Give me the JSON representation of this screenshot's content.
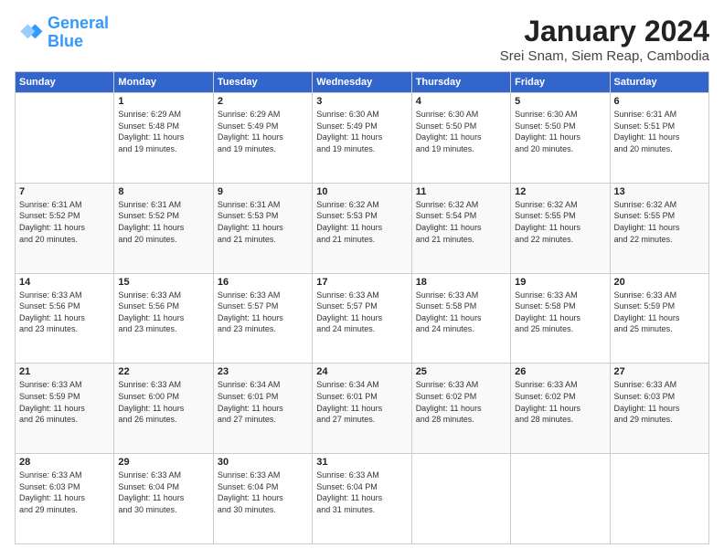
{
  "header": {
    "logo_line1": "General",
    "logo_line2": "Blue",
    "month_title": "January 2024",
    "subtitle": "Srei Snam, Siem Reap, Cambodia"
  },
  "weekdays": [
    "Sunday",
    "Monday",
    "Tuesday",
    "Wednesday",
    "Thursday",
    "Friday",
    "Saturday"
  ],
  "weeks": [
    [
      {
        "day": "",
        "info": ""
      },
      {
        "day": "1",
        "info": "Sunrise: 6:29 AM\nSunset: 5:48 PM\nDaylight: 11 hours\nand 19 minutes."
      },
      {
        "day": "2",
        "info": "Sunrise: 6:29 AM\nSunset: 5:49 PM\nDaylight: 11 hours\nand 19 minutes."
      },
      {
        "day": "3",
        "info": "Sunrise: 6:30 AM\nSunset: 5:49 PM\nDaylight: 11 hours\nand 19 minutes."
      },
      {
        "day": "4",
        "info": "Sunrise: 6:30 AM\nSunset: 5:50 PM\nDaylight: 11 hours\nand 19 minutes."
      },
      {
        "day": "5",
        "info": "Sunrise: 6:30 AM\nSunset: 5:50 PM\nDaylight: 11 hours\nand 20 minutes."
      },
      {
        "day": "6",
        "info": "Sunrise: 6:31 AM\nSunset: 5:51 PM\nDaylight: 11 hours\nand 20 minutes."
      }
    ],
    [
      {
        "day": "7",
        "info": "Sunrise: 6:31 AM\nSunset: 5:52 PM\nDaylight: 11 hours\nand 20 minutes."
      },
      {
        "day": "8",
        "info": "Sunrise: 6:31 AM\nSunset: 5:52 PM\nDaylight: 11 hours\nand 20 minutes."
      },
      {
        "day": "9",
        "info": "Sunrise: 6:31 AM\nSunset: 5:53 PM\nDaylight: 11 hours\nand 21 minutes."
      },
      {
        "day": "10",
        "info": "Sunrise: 6:32 AM\nSunset: 5:53 PM\nDaylight: 11 hours\nand 21 minutes."
      },
      {
        "day": "11",
        "info": "Sunrise: 6:32 AM\nSunset: 5:54 PM\nDaylight: 11 hours\nand 21 minutes."
      },
      {
        "day": "12",
        "info": "Sunrise: 6:32 AM\nSunset: 5:55 PM\nDaylight: 11 hours\nand 22 minutes."
      },
      {
        "day": "13",
        "info": "Sunrise: 6:32 AM\nSunset: 5:55 PM\nDaylight: 11 hours\nand 22 minutes."
      }
    ],
    [
      {
        "day": "14",
        "info": "Sunrise: 6:33 AM\nSunset: 5:56 PM\nDaylight: 11 hours\nand 23 minutes."
      },
      {
        "day": "15",
        "info": "Sunrise: 6:33 AM\nSunset: 5:56 PM\nDaylight: 11 hours\nand 23 minutes."
      },
      {
        "day": "16",
        "info": "Sunrise: 6:33 AM\nSunset: 5:57 PM\nDaylight: 11 hours\nand 23 minutes."
      },
      {
        "day": "17",
        "info": "Sunrise: 6:33 AM\nSunset: 5:57 PM\nDaylight: 11 hours\nand 24 minutes."
      },
      {
        "day": "18",
        "info": "Sunrise: 6:33 AM\nSunset: 5:58 PM\nDaylight: 11 hours\nand 24 minutes."
      },
      {
        "day": "19",
        "info": "Sunrise: 6:33 AM\nSunset: 5:58 PM\nDaylight: 11 hours\nand 25 minutes."
      },
      {
        "day": "20",
        "info": "Sunrise: 6:33 AM\nSunset: 5:59 PM\nDaylight: 11 hours\nand 25 minutes."
      }
    ],
    [
      {
        "day": "21",
        "info": "Sunrise: 6:33 AM\nSunset: 5:59 PM\nDaylight: 11 hours\nand 26 minutes."
      },
      {
        "day": "22",
        "info": "Sunrise: 6:33 AM\nSunset: 6:00 PM\nDaylight: 11 hours\nand 26 minutes."
      },
      {
        "day": "23",
        "info": "Sunrise: 6:34 AM\nSunset: 6:01 PM\nDaylight: 11 hours\nand 27 minutes."
      },
      {
        "day": "24",
        "info": "Sunrise: 6:34 AM\nSunset: 6:01 PM\nDaylight: 11 hours\nand 27 minutes."
      },
      {
        "day": "25",
        "info": "Sunrise: 6:33 AM\nSunset: 6:02 PM\nDaylight: 11 hours\nand 28 minutes."
      },
      {
        "day": "26",
        "info": "Sunrise: 6:33 AM\nSunset: 6:02 PM\nDaylight: 11 hours\nand 28 minutes."
      },
      {
        "day": "27",
        "info": "Sunrise: 6:33 AM\nSunset: 6:03 PM\nDaylight: 11 hours\nand 29 minutes."
      }
    ],
    [
      {
        "day": "28",
        "info": "Sunrise: 6:33 AM\nSunset: 6:03 PM\nDaylight: 11 hours\nand 29 minutes."
      },
      {
        "day": "29",
        "info": "Sunrise: 6:33 AM\nSunset: 6:04 PM\nDaylight: 11 hours\nand 30 minutes."
      },
      {
        "day": "30",
        "info": "Sunrise: 6:33 AM\nSunset: 6:04 PM\nDaylight: 11 hours\nand 30 minutes."
      },
      {
        "day": "31",
        "info": "Sunrise: 6:33 AM\nSunset: 6:04 PM\nDaylight: 11 hours\nand 31 minutes."
      },
      {
        "day": "",
        "info": ""
      },
      {
        "day": "",
        "info": ""
      },
      {
        "day": "",
        "info": ""
      }
    ]
  ]
}
